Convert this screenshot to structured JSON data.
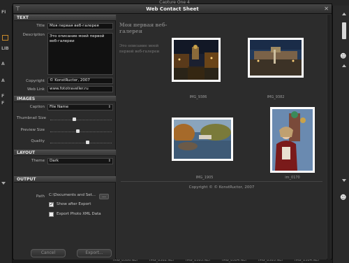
{
  "host": {
    "title": "Capture One 4",
    "left_labels": [
      "FI",
      "LIB",
      "A",
      "A",
      "F",
      "F"
    ],
    "bottom_files": [
      "IMG_8586.NEF",
      "IMG_8582.NEF",
      "IMG_8585.NEF",
      "IMG_8584.NEF",
      "IMG_8585.NEF",
      "IMG_8584.NEF"
    ]
  },
  "dialog": {
    "title": "Web Contact Sheet",
    "pin_icon": "pin-icon",
    "close_label": "✕"
  },
  "sections": {
    "text": "TEXT",
    "images": "IMAGES",
    "layout": "LAYOUT",
    "output": "OUTPUT"
  },
  "text_fields": {
    "title_label": "Title",
    "title_value": "Моя первая веб-галерея",
    "description_label": "Description",
    "description_value": "Это описание моей первой веб-галереи",
    "copyright_label": "Copyright",
    "copyright_value": "© KonstRuctor, 2007",
    "weblink_label": "Web Link",
    "weblink_value": "www.fototraveller.ru"
  },
  "images": {
    "caption_label": "Caption",
    "caption_value": "File Name",
    "thumbnail_label": "Thumbnail Size",
    "thumbnail_level": 0.38,
    "preview_label": "Preview Size",
    "preview_level": 0.45,
    "quality_label": "Quality",
    "quality_level": 0.62
  },
  "layout": {
    "theme_label": "Theme",
    "theme_value": "Dark"
  },
  "output": {
    "path_label": "Path",
    "path_value": "C:\\Documents and Set...",
    "browse_label": "...",
    "show_after_export_label": "Show after Export",
    "show_after_export_checked": true,
    "export_xml_label": "Export Photo XML Data",
    "export_xml_checked": false
  },
  "buttons": {
    "cancel": "Cancel",
    "export": "Export..."
  },
  "preview": {
    "gallery_title": "Моя первая веб-галерея",
    "gallery_description": "Это описание моей первой веб-галереи",
    "thumbnails": [
      {
        "caption": "IMG_9386",
        "scene": "night canal with church"
      },
      {
        "caption": "IMG_9382",
        "scene": "night palace square"
      },
      {
        "caption": "IMG_1905",
        "scene": "autumn park with pond"
      },
      {
        "caption": "im_0170",
        "scene": "portrait by cathedral"
      }
    ],
    "copyright": "Copyright © © KonstRuctor, 2007"
  }
}
